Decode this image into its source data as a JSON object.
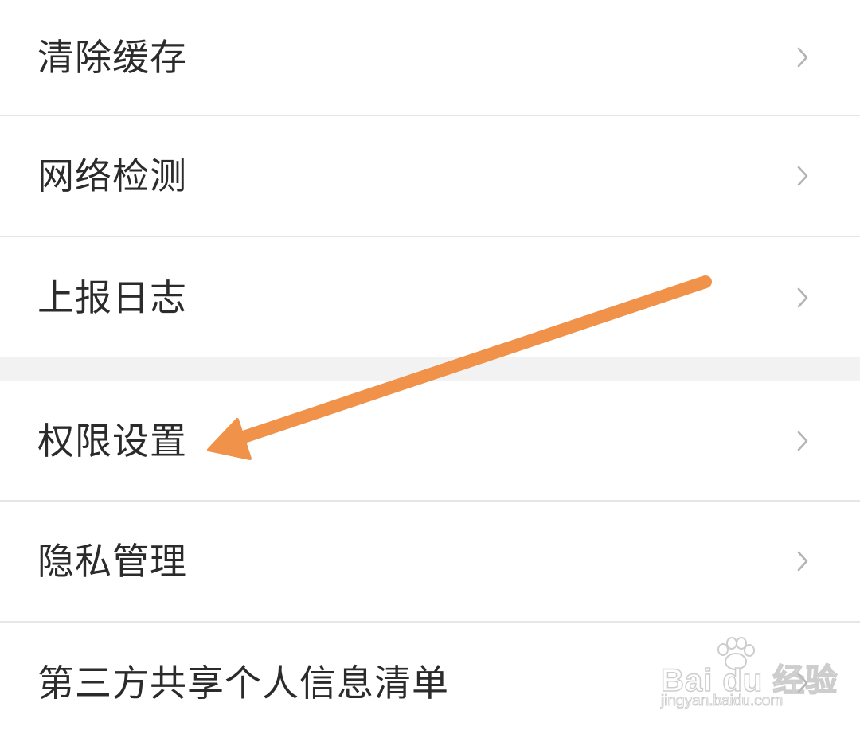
{
  "settings": {
    "items": [
      {
        "label": "清除缓存",
        "icon": "chevron-right-icon"
      },
      {
        "label": "网络检测",
        "icon": "chevron-right-icon"
      },
      {
        "label": "上报日志",
        "icon": "chevron-right-icon"
      },
      {
        "label": "权限设置",
        "icon": "chevron-right-icon"
      },
      {
        "label": "隐私管理",
        "icon": "chevron-right-icon"
      },
      {
        "label": "第三方共享个人信息清单",
        "icon": "chevron-right-icon"
      }
    ]
  },
  "annotation": {
    "type": "arrow",
    "color": "#F0924A",
    "points_to": "权限设置"
  },
  "watermark": {
    "brand": "Bai du 经验",
    "url": "jingyan.baidu.com"
  },
  "colors": {
    "text": "#2b2b2b",
    "chevron": "#b3b3b3",
    "divider": "#e6e6e6",
    "section_gap": "#f2f2f2",
    "arrow": "#F0924A"
  }
}
